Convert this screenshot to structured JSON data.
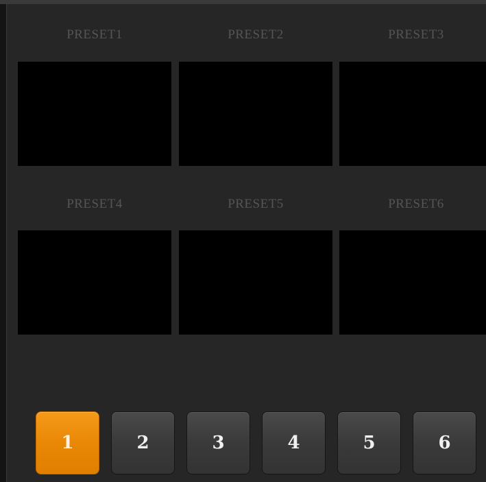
{
  "presets": [
    {
      "label": "PRESET1"
    },
    {
      "label": "PRESET2"
    },
    {
      "label": "PRESET3"
    },
    {
      "label": "PRESET4"
    },
    {
      "label": "PRESET5"
    },
    {
      "label": "PRESET6"
    }
  ],
  "pages": [
    {
      "label": "1",
      "active": true
    },
    {
      "label": "2",
      "active": false
    },
    {
      "label": "3",
      "active": false
    },
    {
      "label": "4",
      "active": false
    },
    {
      "label": "5",
      "active": false
    },
    {
      "label": "6",
      "active": false
    }
  ],
  "colors": {
    "active_page": "#f08c00",
    "thumbnail_background": "#000000",
    "panel_background": "#262626"
  }
}
